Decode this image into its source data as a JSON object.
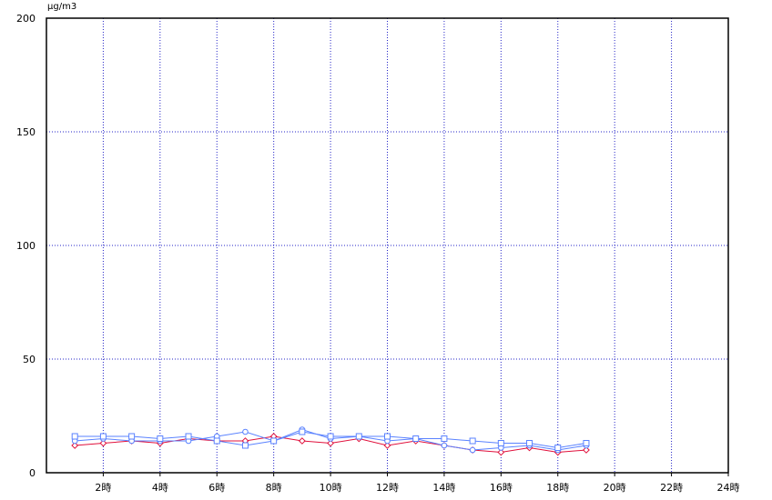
{
  "chart_data": {
    "type": "line",
    "unit_label": "μg/m3",
    "ylim": [
      0,
      200
    ],
    "yticks": [
      0,
      50,
      100,
      150,
      200
    ],
    "xlim": [
      0,
      24
    ],
    "xticks": [
      {
        "x": 2,
        "label": "2時"
      },
      {
        "x": 4,
        "label": "4時"
      },
      {
        "x": 6,
        "label": "6時"
      },
      {
        "x": 8,
        "label": "8時"
      },
      {
        "x": 10,
        "label": "10時"
      },
      {
        "x": 12,
        "label": "12時"
      },
      {
        "x": 14,
        "label": "14時"
      },
      {
        "x": 16,
        "label": "16時"
      },
      {
        "x": 18,
        "label": "18時"
      },
      {
        "x": 20,
        "label": "20時"
      },
      {
        "x": 22,
        "label": "22時"
      },
      {
        "x": 24,
        "label": "24時"
      }
    ],
    "grid": true,
    "series": [
      {
        "color": "#e0103c",
        "marker": "diamond",
        "x": [
          1,
          2,
          3,
          4,
          5,
          6,
          7,
          8,
          9,
          10,
          11,
          12,
          13,
          14,
          15,
          16,
          17,
          18,
          19
        ],
        "values": [
          12,
          13,
          14,
          13,
          15,
          14,
          14,
          16,
          14,
          13,
          15,
          12,
          14,
          12,
          10,
          9,
          11,
          9,
          10
        ]
      },
      {
        "color": "#5a82ff",
        "marker": "circle",
        "x": [
          1,
          2,
          3,
          4,
          5,
          6,
          7,
          8,
          9,
          10,
          11,
          12,
          13,
          14,
          15,
          16,
          17,
          18,
          19
        ],
        "values": [
          14,
          15,
          14,
          14,
          14,
          16,
          18,
          14,
          19,
          15,
          16,
          14,
          15,
          12,
          10,
          11,
          12,
          10,
          12
        ]
      },
      {
        "color": "#5a82ff",
        "marker": "square",
        "x": [
          1,
          2,
          3,
          4,
          5,
          6,
          7,
          8,
          9,
          10,
          11,
          12,
          13,
          14,
          15,
          16,
          17,
          18,
          19
        ],
        "values": [
          16,
          16,
          16,
          15,
          16,
          14,
          12,
          14,
          18,
          16,
          16,
          16,
          15,
          15,
          14,
          13,
          13,
          11,
          13
        ]
      }
    ]
  }
}
